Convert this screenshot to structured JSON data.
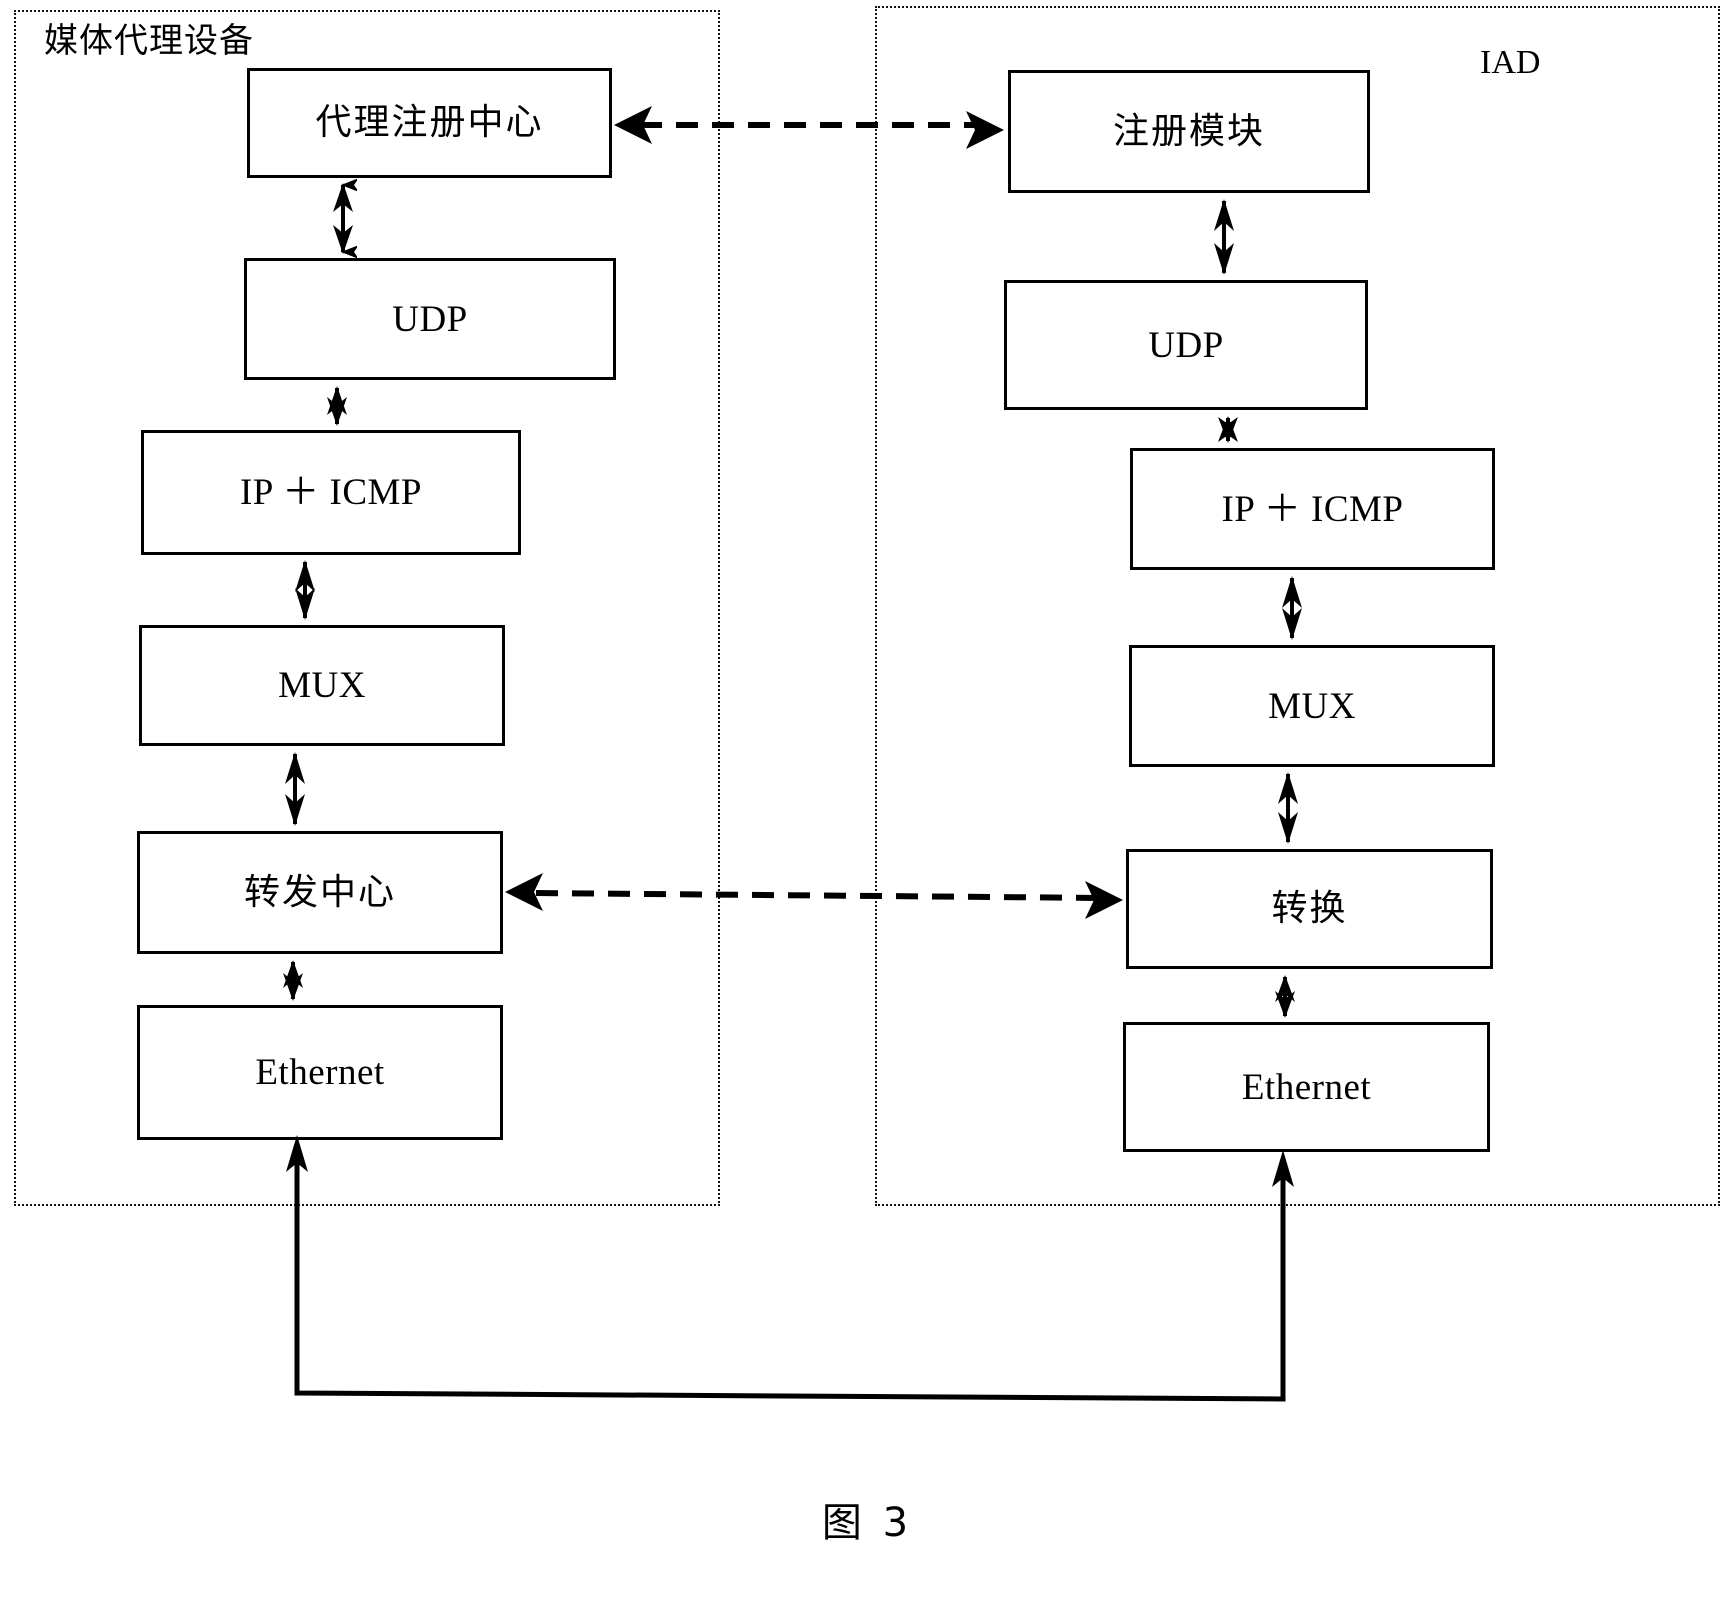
{
  "figure": {
    "caption": "图 3",
    "panels": [
      {
        "id": "media-proxy-device",
        "label": "媒体代理设备",
        "script": "cjk"
      },
      {
        "id": "iad",
        "label": "IAD",
        "script": "latin"
      }
    ],
    "left_stack": [
      {
        "id": "proxy-registration-center",
        "label": "代理注册中心",
        "script": "cjk"
      },
      {
        "id": "udp-left",
        "label": "UDP",
        "script": "latin"
      },
      {
        "id": "ip-icmp-left",
        "label": "IP ＋ ICMP",
        "script": "latin"
      },
      {
        "id": "mux-left",
        "label": "MUX",
        "script": "latin"
      },
      {
        "id": "forwarding-center",
        "label": "转发中心",
        "script": "cjk"
      },
      {
        "id": "ethernet-left",
        "label": "Ethernet",
        "script": "latin"
      }
    ],
    "right_stack": [
      {
        "id": "registration-module",
        "label": "注册模块",
        "script": "cjk"
      },
      {
        "id": "udp-right",
        "label": "UDP",
        "script": "latin"
      },
      {
        "id": "ip-icmp-right",
        "label": "IP ＋ ICMP",
        "script": "latin"
      },
      {
        "id": "mux-right",
        "label": "MUX",
        "script": "latin"
      },
      {
        "id": "conversion",
        "label": "转换",
        "script": "cjk"
      },
      {
        "id": "ethernet-right",
        "label": "Ethernet",
        "script": "latin"
      }
    ],
    "connectors": [
      {
        "id": "registration-link",
        "style": "dashed",
        "direction": "bidirectional",
        "from": "proxy-registration-center",
        "to": "registration-module"
      },
      {
        "id": "media-link",
        "style": "dashed",
        "direction": "bidirectional",
        "from": "forwarding-center",
        "to": "conversion"
      },
      {
        "id": "physical-link",
        "style": "solid",
        "direction": "bidirectional",
        "from": "ethernet-left",
        "to": "ethernet-right"
      }
    ],
    "colors": {
      "stroke": "#000000",
      "panel_border": "#111111",
      "background": "#ffffff"
    }
  }
}
